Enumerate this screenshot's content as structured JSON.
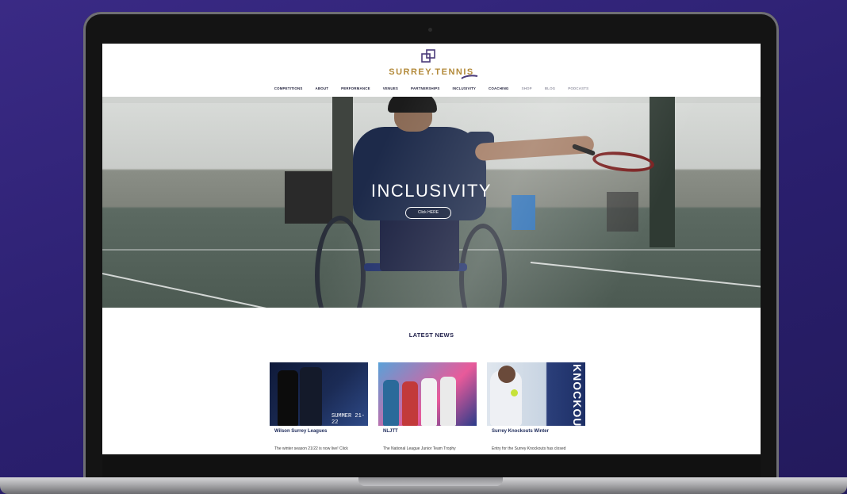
{
  "site": {
    "logo_text": "SURREY.TENNIS"
  },
  "nav": {
    "items": [
      {
        "label": "COMPETITIONS"
      },
      {
        "label": "ABOUT"
      },
      {
        "label": "PERFORMANCE"
      },
      {
        "label": "VENUES"
      },
      {
        "label": "PARTNERSHIPS"
      },
      {
        "label": "INCLUSIVITY"
      },
      {
        "label": "COACHING"
      },
      {
        "label": "SHOP"
      },
      {
        "label": "BLOG"
      },
      {
        "label": "PODCASTS"
      }
    ]
  },
  "hero": {
    "title": "INCLUSIVITY",
    "button_label": "Click HERE"
  },
  "news": {
    "section_title": "LATEST NEWS",
    "cards": [
      {
        "title": "Wilson Surrey Leagues",
        "excerpt": "The winter season 21/22 is now live! Click",
        "thumb_caption": "SUMMER 21-22"
      },
      {
        "title": "NLJTT",
        "excerpt": "The National League Junior Team Trophy",
        "thumb_caption": ""
      },
      {
        "title": "Surrey Knockouts Winter",
        "excerpt": "Entry for the Surrey Knockouts has closed",
        "thumb_caption": "KNOCKOUTS"
      }
    ]
  },
  "colors": {
    "background": "#2a1f6e",
    "brand_gold": "#b38a3a",
    "navy": "#1f1f4a"
  }
}
